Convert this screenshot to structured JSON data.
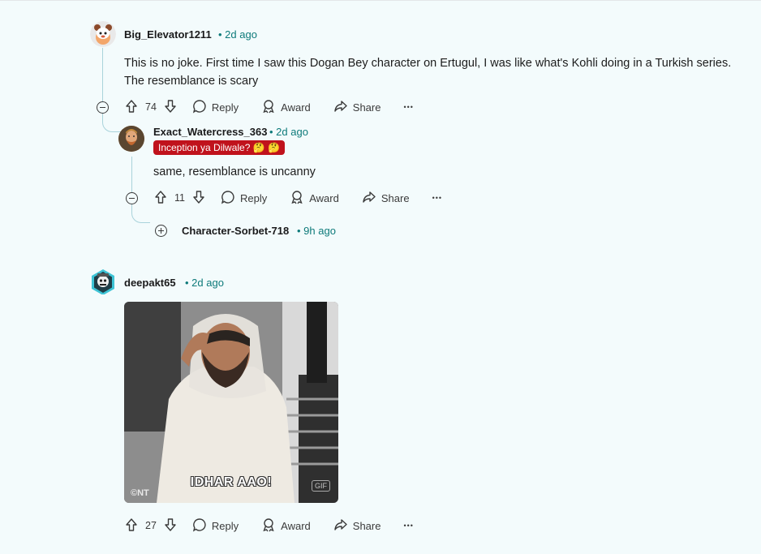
{
  "comments": [
    {
      "username": "Big_Elevator1211",
      "time": "• 2d ago",
      "body": "This is no joke. First time I saw this Dogan Bey character on Ertugul, I was like what's Kohli doing in a Turkish series. The resemblance is scary",
      "votes": "74",
      "reply": "Reply",
      "award": "Award",
      "share": "Share",
      "more": "•••"
    },
    {
      "username": "Exact_Watercress_363",
      "time": "• 2d ago",
      "flair": "Inception ya Dilwale? 🤔 🤔",
      "body": "same, resemblance is uncanny",
      "votes": "11",
      "reply": "Reply",
      "award": "Award",
      "share": "Share",
      "more": "•••"
    },
    {
      "username": "Character-Sorbet-718",
      "time": "• 9h ago"
    },
    {
      "username": "deepakt65",
      "time": "• 2d ago",
      "gif_caption": "IDHAR AAO!",
      "gif_watermark": "©NT",
      "gif_badge": "GIF",
      "votes": "27",
      "reply": "Reply",
      "award": "Award",
      "share": "Share",
      "more": "•••"
    }
  ],
  "icons": {
    "upvote": "arrow-up-icon",
    "downvote": "arrow-down-icon",
    "reply": "speech-bubble-icon",
    "award": "award-ribbon-icon",
    "share": "share-arrow-icon",
    "collapse": "minus-circle-icon",
    "expand": "plus-circle-icon"
  },
  "colors": {
    "background": "#f3fbfc",
    "timestamp": "#0d7a7a",
    "flair": "#c0121c",
    "thread_line": "#a9d3db"
  }
}
